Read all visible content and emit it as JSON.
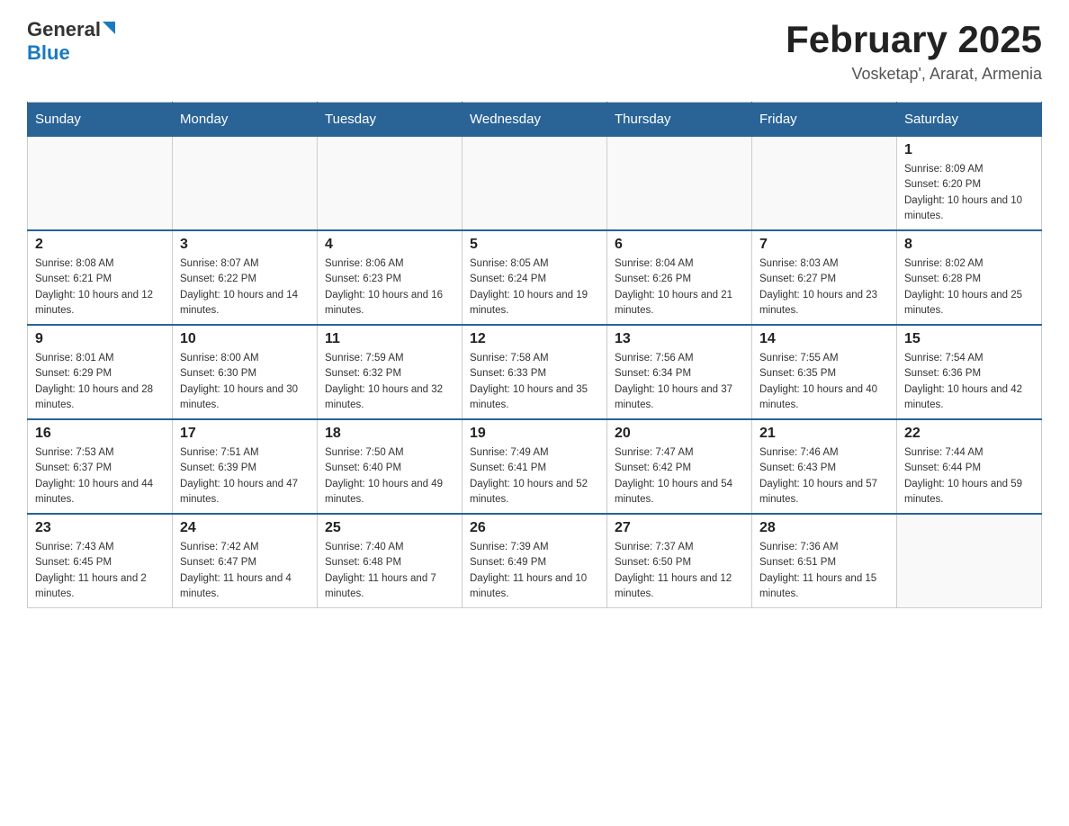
{
  "header": {
    "logo_general": "General",
    "logo_blue": "Blue",
    "month_title": "February 2025",
    "location": "Vosketap', Ararat, Armenia"
  },
  "days_of_week": [
    "Sunday",
    "Monday",
    "Tuesday",
    "Wednesday",
    "Thursday",
    "Friday",
    "Saturday"
  ],
  "weeks": [
    [
      {
        "day": "",
        "info": ""
      },
      {
        "day": "",
        "info": ""
      },
      {
        "day": "",
        "info": ""
      },
      {
        "day": "",
        "info": ""
      },
      {
        "day": "",
        "info": ""
      },
      {
        "day": "",
        "info": ""
      },
      {
        "day": "1",
        "info": "Sunrise: 8:09 AM\nSunset: 6:20 PM\nDaylight: 10 hours and 10 minutes."
      }
    ],
    [
      {
        "day": "2",
        "info": "Sunrise: 8:08 AM\nSunset: 6:21 PM\nDaylight: 10 hours and 12 minutes."
      },
      {
        "day": "3",
        "info": "Sunrise: 8:07 AM\nSunset: 6:22 PM\nDaylight: 10 hours and 14 minutes."
      },
      {
        "day": "4",
        "info": "Sunrise: 8:06 AM\nSunset: 6:23 PM\nDaylight: 10 hours and 16 minutes."
      },
      {
        "day": "5",
        "info": "Sunrise: 8:05 AM\nSunset: 6:24 PM\nDaylight: 10 hours and 19 minutes."
      },
      {
        "day": "6",
        "info": "Sunrise: 8:04 AM\nSunset: 6:26 PM\nDaylight: 10 hours and 21 minutes."
      },
      {
        "day": "7",
        "info": "Sunrise: 8:03 AM\nSunset: 6:27 PM\nDaylight: 10 hours and 23 minutes."
      },
      {
        "day": "8",
        "info": "Sunrise: 8:02 AM\nSunset: 6:28 PM\nDaylight: 10 hours and 25 minutes."
      }
    ],
    [
      {
        "day": "9",
        "info": "Sunrise: 8:01 AM\nSunset: 6:29 PM\nDaylight: 10 hours and 28 minutes."
      },
      {
        "day": "10",
        "info": "Sunrise: 8:00 AM\nSunset: 6:30 PM\nDaylight: 10 hours and 30 minutes."
      },
      {
        "day": "11",
        "info": "Sunrise: 7:59 AM\nSunset: 6:32 PM\nDaylight: 10 hours and 32 minutes."
      },
      {
        "day": "12",
        "info": "Sunrise: 7:58 AM\nSunset: 6:33 PM\nDaylight: 10 hours and 35 minutes."
      },
      {
        "day": "13",
        "info": "Sunrise: 7:56 AM\nSunset: 6:34 PM\nDaylight: 10 hours and 37 minutes."
      },
      {
        "day": "14",
        "info": "Sunrise: 7:55 AM\nSunset: 6:35 PM\nDaylight: 10 hours and 40 minutes."
      },
      {
        "day": "15",
        "info": "Sunrise: 7:54 AM\nSunset: 6:36 PM\nDaylight: 10 hours and 42 minutes."
      }
    ],
    [
      {
        "day": "16",
        "info": "Sunrise: 7:53 AM\nSunset: 6:37 PM\nDaylight: 10 hours and 44 minutes."
      },
      {
        "day": "17",
        "info": "Sunrise: 7:51 AM\nSunset: 6:39 PM\nDaylight: 10 hours and 47 minutes."
      },
      {
        "day": "18",
        "info": "Sunrise: 7:50 AM\nSunset: 6:40 PM\nDaylight: 10 hours and 49 minutes."
      },
      {
        "day": "19",
        "info": "Sunrise: 7:49 AM\nSunset: 6:41 PM\nDaylight: 10 hours and 52 minutes."
      },
      {
        "day": "20",
        "info": "Sunrise: 7:47 AM\nSunset: 6:42 PM\nDaylight: 10 hours and 54 minutes."
      },
      {
        "day": "21",
        "info": "Sunrise: 7:46 AM\nSunset: 6:43 PM\nDaylight: 10 hours and 57 minutes."
      },
      {
        "day": "22",
        "info": "Sunrise: 7:44 AM\nSunset: 6:44 PM\nDaylight: 10 hours and 59 minutes."
      }
    ],
    [
      {
        "day": "23",
        "info": "Sunrise: 7:43 AM\nSunset: 6:45 PM\nDaylight: 11 hours and 2 minutes."
      },
      {
        "day": "24",
        "info": "Sunrise: 7:42 AM\nSunset: 6:47 PM\nDaylight: 11 hours and 4 minutes."
      },
      {
        "day": "25",
        "info": "Sunrise: 7:40 AM\nSunset: 6:48 PM\nDaylight: 11 hours and 7 minutes."
      },
      {
        "day": "26",
        "info": "Sunrise: 7:39 AM\nSunset: 6:49 PM\nDaylight: 11 hours and 10 minutes."
      },
      {
        "day": "27",
        "info": "Sunrise: 7:37 AM\nSunset: 6:50 PM\nDaylight: 11 hours and 12 minutes."
      },
      {
        "day": "28",
        "info": "Sunrise: 7:36 AM\nSunset: 6:51 PM\nDaylight: 11 hours and 15 minutes."
      },
      {
        "day": "",
        "info": ""
      }
    ]
  ]
}
